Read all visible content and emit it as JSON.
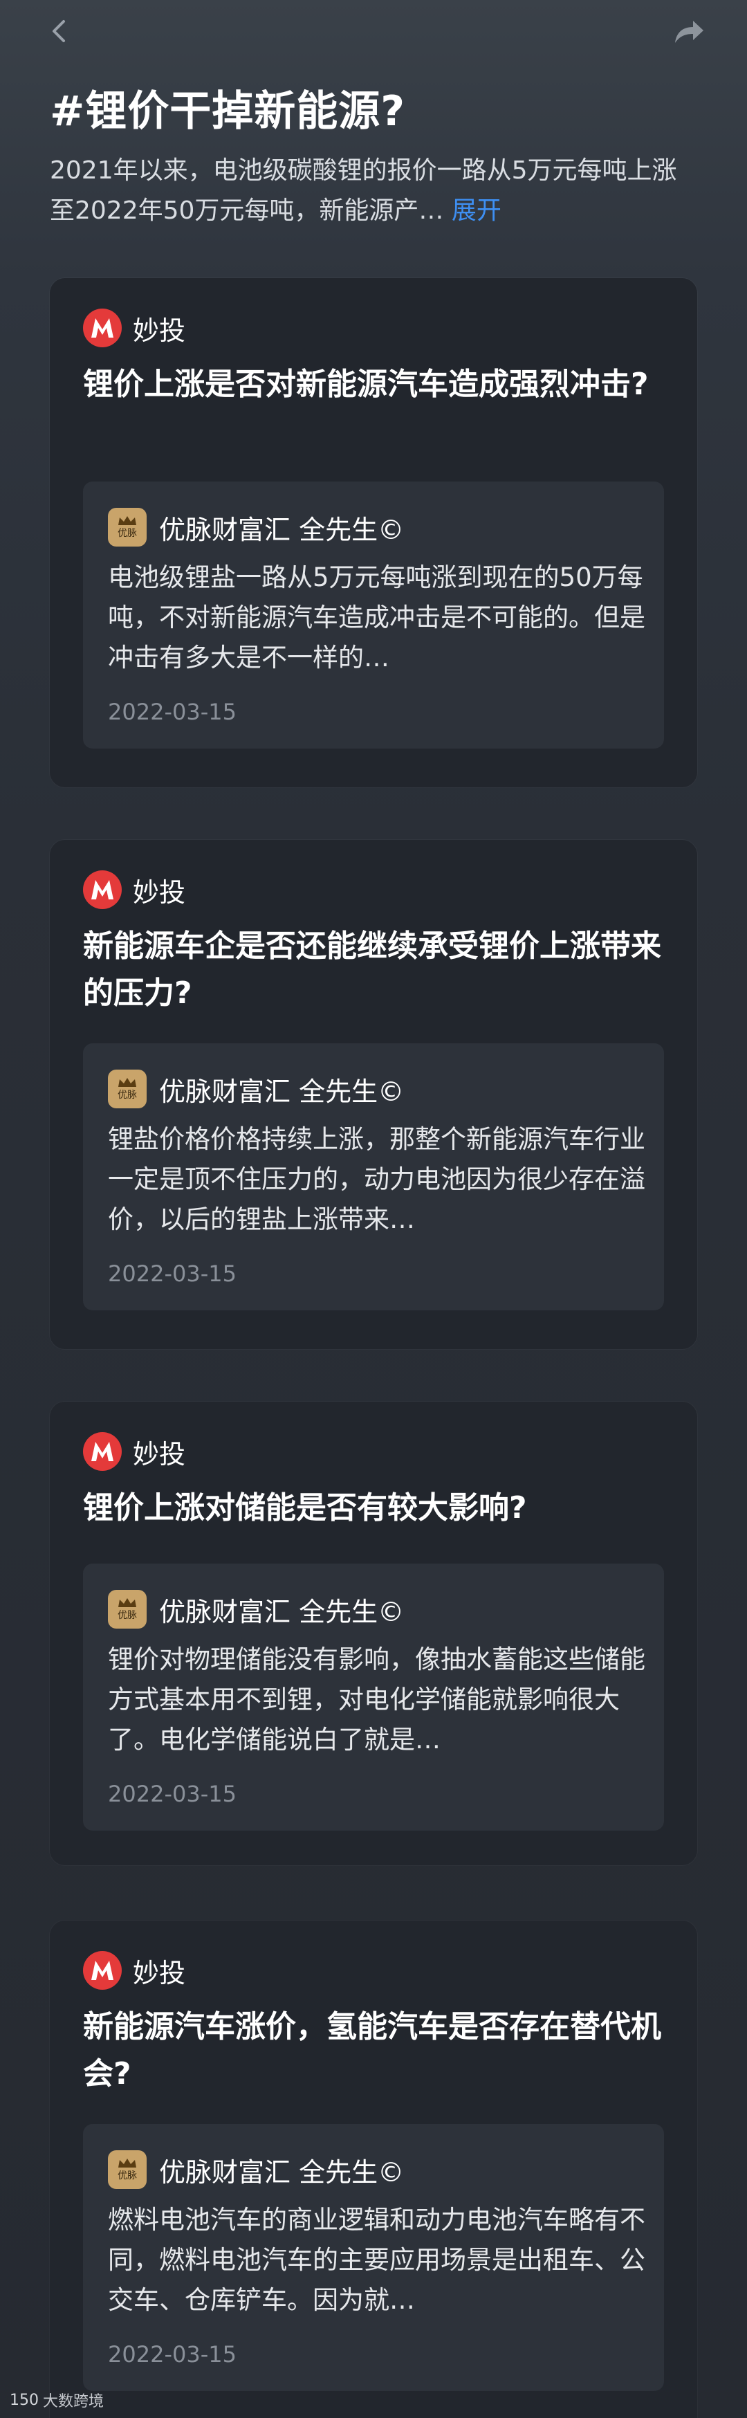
{
  "topic": {
    "title": "#锂价干掉新能源?",
    "description": "2021年以来，电池级碳酸锂的报价一路从5万元每吨上涨至2022年50万元每吨，新能源产…",
    "expand_label": "展开"
  },
  "cards": [
    {
      "brand": "妙投",
      "question": "锂价上涨是否对新能源汽车造成强烈冲击?",
      "answer": {
        "avatar_text": "优脉",
        "author": "优脉财富汇 全先生©",
        "text": "电池级锂盐一路从5万元每吨涨到现在的50万每吨，不对新能源汽车造成冲击是不可能的。但是冲击有多大是不一样的…",
        "date": "2022-03-15"
      }
    },
    {
      "brand": "妙投",
      "question": "新能源车企是否还能继续承受锂价上涨带来的压力?",
      "answer": {
        "avatar_text": "优脉",
        "author": "优脉财富汇 全先生©",
        "text": "锂盐价格价格持续上涨，那整个新能源汽车行业一定是顶不住压力的，动力电池因为很少存在溢价，以后的锂盐上涨带来…",
        "date": "2022-03-15"
      }
    },
    {
      "brand": "妙投",
      "question": "锂价上涨对储能是否有较大影响?",
      "answer": {
        "avatar_text": "优脉",
        "author": "优脉财富汇 全先生©",
        "text": "锂价对物理储能没有影响，像抽水蓄能这些储能方式基本用不到锂，对电化学储能就影响很大了。电化学储能说白了就是…",
        "date": "2022-03-15"
      }
    },
    {
      "brand": "妙投",
      "question": "新能源汽车涨价，氢能汽车是否存在替代机会?",
      "answer": {
        "avatar_text": "优脉",
        "author": "优脉财富汇 全先生©",
        "text": "燃料电池汽车的商业逻辑和动力电池汽车略有不同，燃料电池汽车的主要应用场景是出租车、公交车、仓库铲车。因为就…",
        "date": "2022-03-15"
      }
    }
  ],
  "watermark": {
    "mark": "150",
    "text": "大数跨境"
  },
  "icons": {
    "back": "chevron-left-icon",
    "share": "share-arrow-icon",
    "brand": "miaotou-logo-icon",
    "avatar": "crown-avatar-icon"
  },
  "colors": {
    "accent_link": "#3e8ff2",
    "brand_red": "#e43a3a",
    "avatar_gold": "#c9a46a"
  }
}
